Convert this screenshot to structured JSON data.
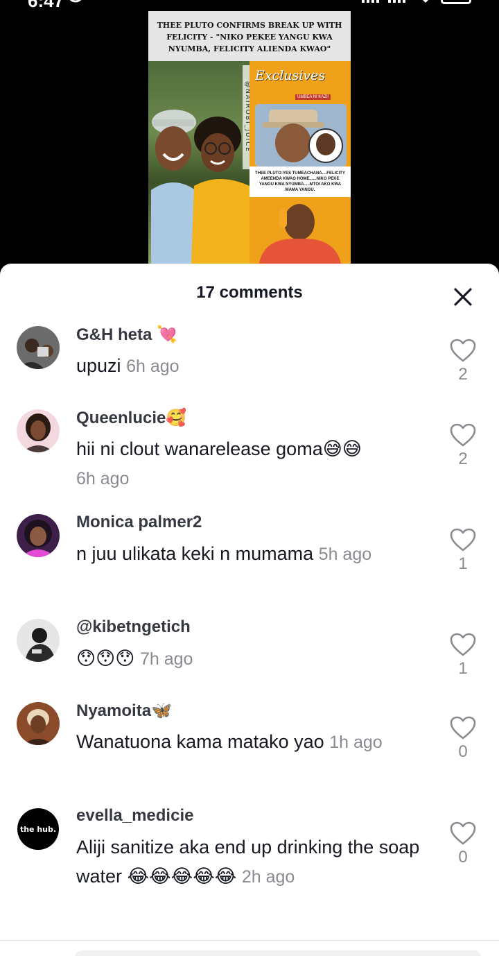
{
  "status_bar": {
    "time": "6:47"
  },
  "video": {
    "headline": "THEE PLUTO CONFIRMS BREAK UP WITH FELICITY - \"NIKO PEKEE YANGU KWA NYUMBA, FELICITY ALIENDA KWAO\"",
    "watermark": "@NAIROBI_JUICE",
    "brand": "Exclusives",
    "brand_sub": "UMBEA NI KAZI!",
    "quote": "THEE PLUTO:YES TUMEACHANA....FELICITY AMEENDA KWAO HOME......NIKO PEKE YANGU KWA NYUMBA.....MTOI AKO KWA MAMA YANGU."
  },
  "sheet": {
    "title": "17 comments",
    "comments": [
      {
        "user": "G&H heta",
        "text": "upuzi",
        "time": "6h ago",
        "likes": "2",
        "avatar": "couple-photo"
      },
      {
        "user": "Queenlucie",
        "text": "hii ni clout wanarelease goma",
        "time": "6h ago",
        "likes": "2",
        "avatar": "woman-photo"
      },
      {
        "user": "Monica palmer2",
        "text": "n juu ulikata keki n mumama",
        "time": "5h ago",
        "likes": "1",
        "avatar": "woman-pink-photo"
      },
      {
        "user": "@kibetngetich",
        "text": "",
        "time": "7h ago",
        "likes": "1",
        "avatar": "man-photo"
      },
      {
        "user": "Nyamoita",
        "text": "Wanatuona kama matako yao",
        "time": "1h ago",
        "likes": "0",
        "avatar": "woman-blonde-photo"
      },
      {
        "user": "evella_medicie",
        "text": "Aliji sanitize aka end up drinking the soap water",
        "time": "2h ago",
        "likes": "0",
        "avatar": "the-hub-logo",
        "avatar_text": "the hub."
      }
    ]
  },
  "colors": {
    "sheet_bg": "#ffffff",
    "muted": "#8a8b91",
    "text": "#161823"
  }
}
